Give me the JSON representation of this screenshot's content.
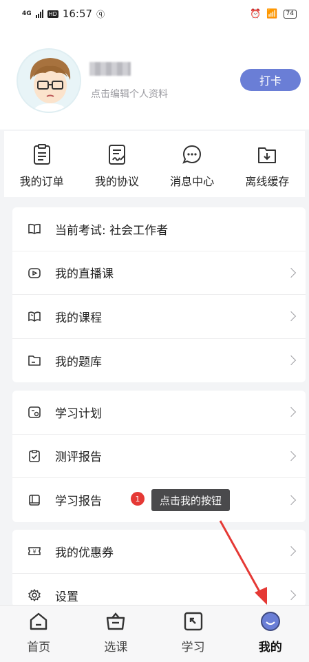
{
  "status": {
    "network": "4G",
    "hd": "HD",
    "time": "16:57",
    "battery": "74"
  },
  "profile": {
    "edit_hint": "点击编辑个人资料",
    "checkin_label": "打卡"
  },
  "quick_actions": [
    {
      "label": "我的订单",
      "icon": "clipboard-list-icon"
    },
    {
      "label": "我的协议",
      "icon": "document-sign-icon"
    },
    {
      "label": "消息中心",
      "icon": "chat-bubble-icon"
    },
    {
      "label": "离线缓存",
      "icon": "folder-download-icon"
    }
  ],
  "menu_group1": [
    {
      "label": "当前考试: 社会工作者",
      "icon": "open-book-icon",
      "chevron": false
    },
    {
      "label": "我的直播课",
      "icon": "live-video-icon",
      "chevron": true
    },
    {
      "label": "我的课程",
      "icon": "book-icon",
      "chevron": true
    },
    {
      "label": "我的题库",
      "icon": "folder-icon",
      "chevron": true
    }
  ],
  "menu_group2": [
    {
      "label": "学习计划",
      "icon": "calendar-icon",
      "chevron": true
    },
    {
      "label": "测评报告",
      "icon": "clipboard-check-icon",
      "chevron": true
    },
    {
      "label": "学习报告",
      "icon": "notebook-icon",
      "chevron": true
    }
  ],
  "menu_group3": [
    {
      "label": "我的优惠券",
      "icon": "coupon-icon",
      "chevron": true
    },
    {
      "label": "设置",
      "icon": "gear-icon",
      "chevron": true
    }
  ],
  "tooltip": {
    "step": "1",
    "text": "点击我的按钮"
  },
  "tabs": [
    {
      "label": "首页",
      "icon": "home-icon"
    },
    {
      "label": "选课",
      "icon": "basket-icon"
    },
    {
      "label": "学习",
      "icon": "study-icon"
    },
    {
      "label": "我的",
      "icon": "profile-icon"
    }
  ],
  "colors": {
    "accent": "#6a7ed6",
    "badge": "#e53935",
    "arrow": "#e53935"
  }
}
